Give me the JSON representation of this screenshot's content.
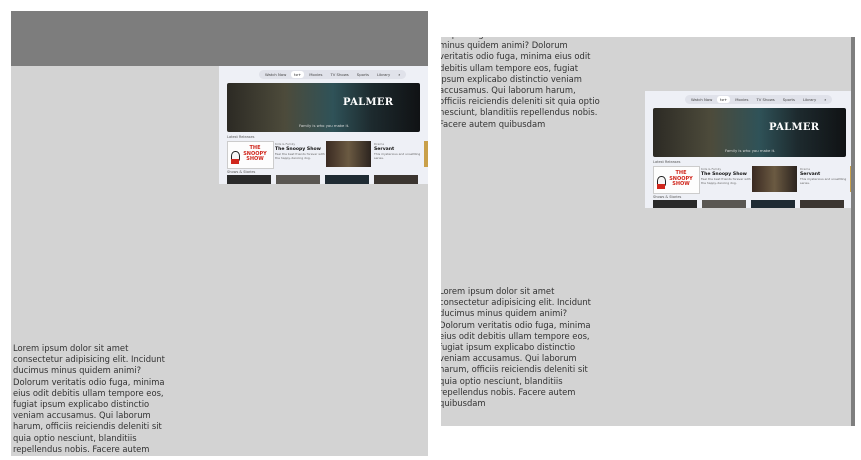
{
  "lorem_text": "Lorem ipsum dolor sit amet consectetur adipisicing elit. Incidunt ducimus minus quidem animi? Dolorum veritatis odio fuga, minima eius odit debitis ullam tempore eos, fugiat ipsum explicabo distinctio veniam accusamus. Qui laborum harum, officiis reiciendis deleniti sit quia optio nesciunt, blanditiis repellendus nobis. Facere autem quibusdam",
  "right_top_text": "adipisicing elit. Incidunt ducimus minus quidem animi? Dolorum veritatis odio fuga, minima eius odit debitis ullam tempore eos, fugiat ipsum explicabo distinctio veniam accusamus. Qui laborum harum, officiis reiciendis deleniti sit quia optio nesciunt, blanditiis repellendus nobis. Facere autem quibusdam",
  "tv": {
    "nav": [
      "Watch Now",
      "tv+",
      "Movies",
      "TV Shows",
      "Sports",
      "Library",
      "⌕"
    ],
    "active_index": 1,
    "hero_title": "PALMER",
    "hero_subtitle": "Family is who you make it.",
    "section_latest": "Latest Releases",
    "section_shows": "Shows & Stories",
    "show1": {
      "genre": "Kids & Family",
      "title": "The Snoopy Show",
      "desc": "Feel the best friends forever with the happy-dancing dog."
    },
    "show2": {
      "genre": "Drama",
      "title": "Servant",
      "desc": "This mysterious and unsettling series."
    },
    "snoopy_logo": "THE SNOOPY SHOW"
  }
}
